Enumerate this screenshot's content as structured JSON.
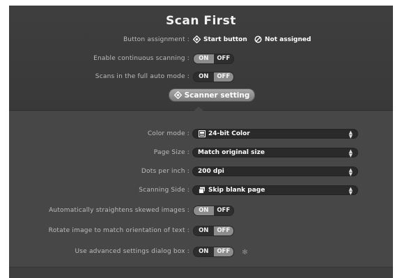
{
  "title": "Scan First",
  "button_assignment": {
    "label": "Button assignment :",
    "option_start": "Start button",
    "option_none": "Not assigned"
  },
  "continuous": {
    "label": "Enable continuous scanning :",
    "on": "ON",
    "off": "OFF",
    "state": "ON"
  },
  "full_auto": {
    "label": "Scans in the full auto mode :",
    "on": "ON",
    "off": "OFF",
    "state": "OFF"
  },
  "scanner_setting_button": "Scanner setting",
  "settings": {
    "color_mode": {
      "label": "Color mode :",
      "value": "24-bit Color",
      "icon": "color-image-icon"
    },
    "page_size": {
      "label": "Page Size :",
      "value": "Match original size"
    },
    "dpi": {
      "label": "Dots per inch :",
      "value": "200 dpi"
    },
    "side": {
      "label": "Scanning Side :",
      "value": "Skip blank page",
      "icon": "page-stack-icon"
    },
    "straighten": {
      "label": "Automatically straightens skewed images :",
      "on": "ON",
      "off": "OFF",
      "state": "ON"
    },
    "rotate": {
      "label": "Rotate image to match orientation of text :",
      "on": "ON",
      "off": "OFF",
      "state": "OFF"
    },
    "advanced": {
      "label": "Use advanced settings dialog box :",
      "on": "ON",
      "off": "OFF",
      "state": "OFF",
      "icon": "gear-icon"
    }
  },
  "colors": {
    "panel_dark": "#3b3b3b",
    "panel_body": "#474747",
    "toggle_active": "#8c8c8c",
    "select_bg": "#2a2a2a"
  }
}
